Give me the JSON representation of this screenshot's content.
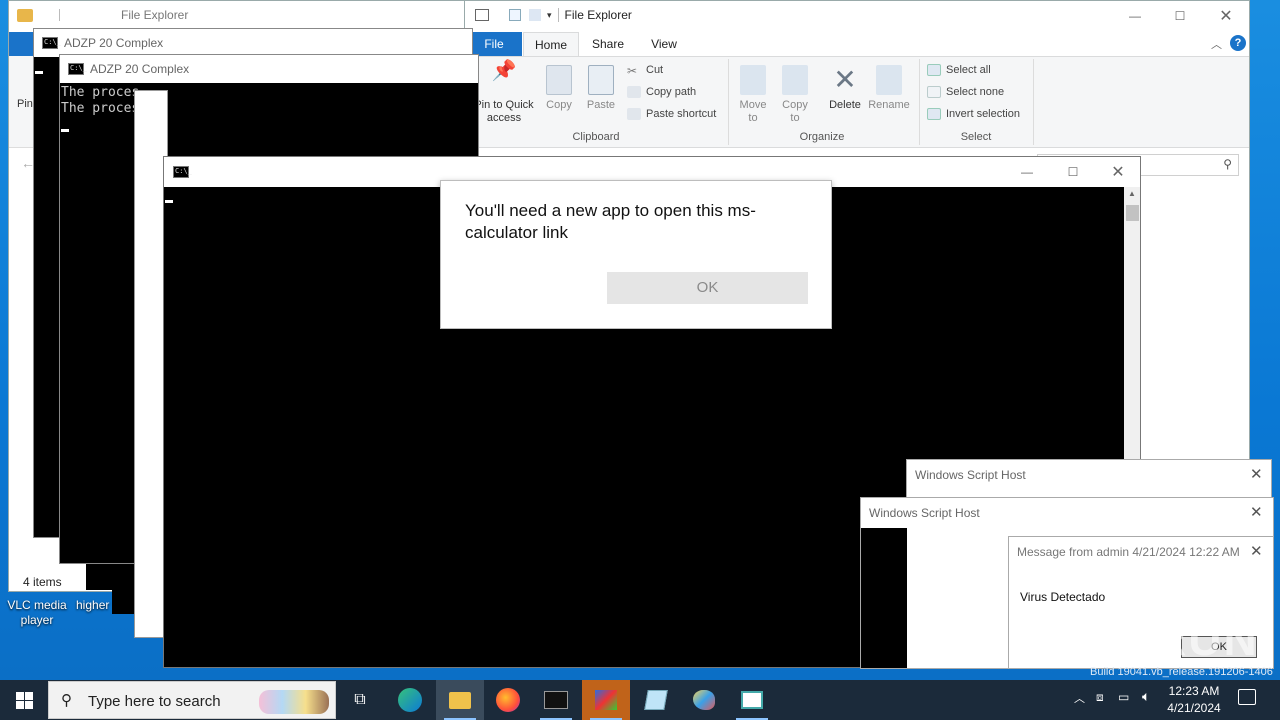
{
  "explorer_left": {
    "title": "File Explorer",
    "status": "4 items",
    "nav_label": "Pin"
  },
  "explorer_right": {
    "title": "File Explorer",
    "tabs": [
      "File",
      "Home",
      "Share",
      "View"
    ],
    "clipboard": {
      "pin": "Pin to Quick access",
      "copy": "Copy",
      "paste": "Paste",
      "cut": "Cut",
      "copy_path": "Copy path",
      "paste_shortcut": "Paste shortcut",
      "group": "Clipboard"
    },
    "organize": {
      "move_to": "Move to",
      "copy_to": "Copy to",
      "delete": "Delete",
      "rename": "Rename",
      "group": "Organize"
    },
    "select": {
      "select_all": "Select all",
      "select_none": "Select none",
      "invert": "Invert selection",
      "group": "Select"
    }
  },
  "cmd1": {
    "title": "ADZP 20 Complex"
  },
  "cmd2": {
    "title": "ADZP 20 Complex",
    "line1": "The proces",
    "line2": "The proces"
  },
  "dialog": {
    "message": "You'll need a new app to open this ms-calculator link",
    "ok": "OK"
  },
  "wsh1": {
    "title": "Windows Script Host"
  },
  "wsh2": {
    "title": "Windows Script Host"
  },
  "msg": {
    "title": "Message from admin 4/21/2024 12:22 AM",
    "body": "Virus Detectado",
    "ok": "OK"
  },
  "desktop": {
    "vlc_label": "VLC media player",
    "higher_label": "higher",
    "build": "Build 19041.vb_release.191206-1406",
    "watermark": "ANY RUN"
  },
  "taskbar": {
    "search_placeholder": "Type here to search",
    "time": "12:23 AM",
    "date": "4/21/2024"
  },
  "colors": {
    "accent": "#1a73c9",
    "taskbar": "#1b2a3a",
    "desktop": "#0a7fd6"
  }
}
